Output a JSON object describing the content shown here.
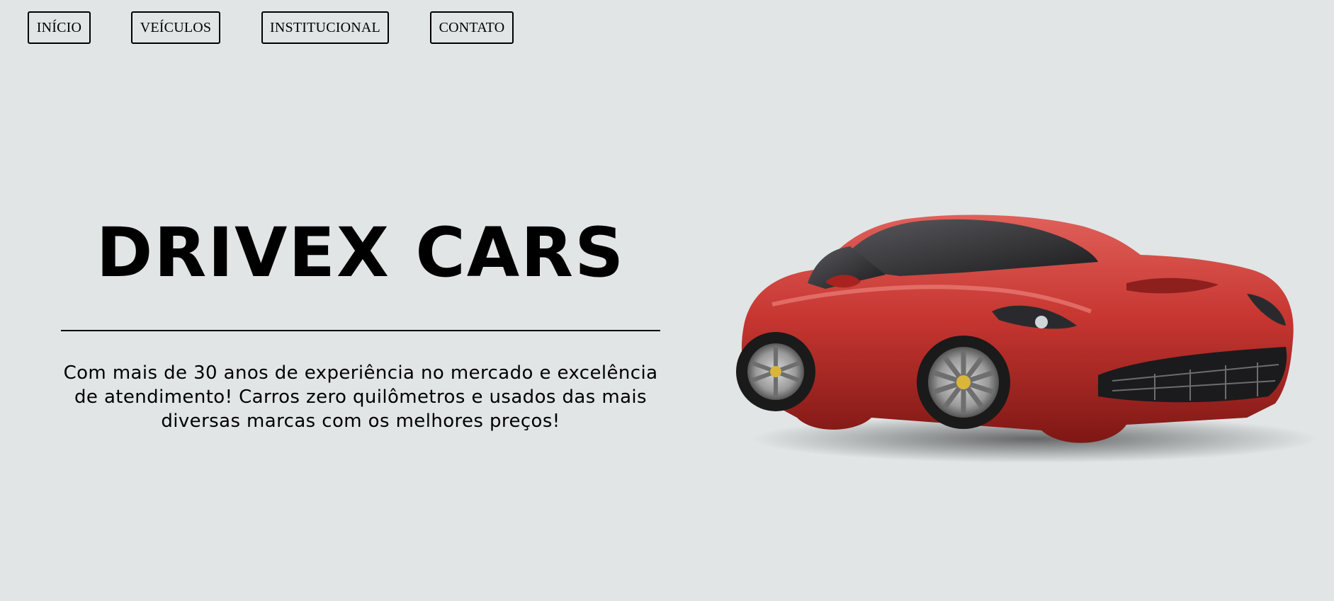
{
  "nav": {
    "items": [
      {
        "label": "INÍCIO"
      },
      {
        "label": "VEÍCULOS"
      },
      {
        "label": "INSTITUCIONAL"
      },
      {
        "label": "CONTATO"
      }
    ]
  },
  "hero": {
    "title": "DRIVEX CARS",
    "description": "Com mais de 30 anos de experiência no mercado e excelência de atendimento! Carros zero quilômetros e usados das mais diversas marcas com os melhores preços!"
  },
  "colors": {
    "background": "#e1e5e6",
    "text": "#000000",
    "car_body": "#c8332f"
  },
  "image": {
    "subject": "red-sports-car"
  }
}
